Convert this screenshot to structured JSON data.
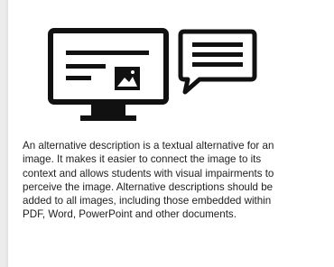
{
  "card": {
    "illustration_icons": [
      "monitor-icon",
      "image-icon",
      "speech-bubble-icon"
    ],
    "description": "An alternative description is a textual alternative for an image. It makes it easier to connect the image to its context and allows students with visual impairments to perceive the image. Alternative descriptions should be added to all images, including those embedded within PDF, Word, PowerPoint and other documents."
  },
  "colors": {
    "icon": "#111111",
    "background": "#ffffff",
    "text": "#1e1e1e"
  }
}
